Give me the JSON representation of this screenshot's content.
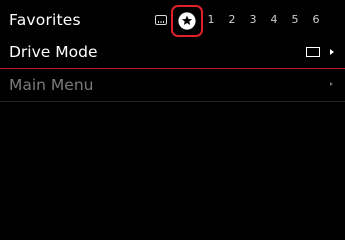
{
  "header": {
    "title": "Favorites"
  },
  "tabs": {
    "menu_icon": "menu-list-icon",
    "favorites_icon": "star-circle-icon",
    "numbers": [
      "1",
      "2",
      "3",
      "4",
      "5",
      "6"
    ],
    "selected": "favorites"
  },
  "rows": [
    {
      "label": "Drive Mode",
      "value_icon": "single-frame-icon",
      "arrow_icon": "chevron-right-icon",
      "state": "selected"
    },
    {
      "label": "Main Menu",
      "arrow_icon": "chevron-right-icon",
      "state": "inactive"
    }
  ],
  "colors": {
    "background": "#000000",
    "accent": "#e0202a",
    "text_primary": "#ffffff",
    "text_inactive": "#7a7a7a"
  }
}
